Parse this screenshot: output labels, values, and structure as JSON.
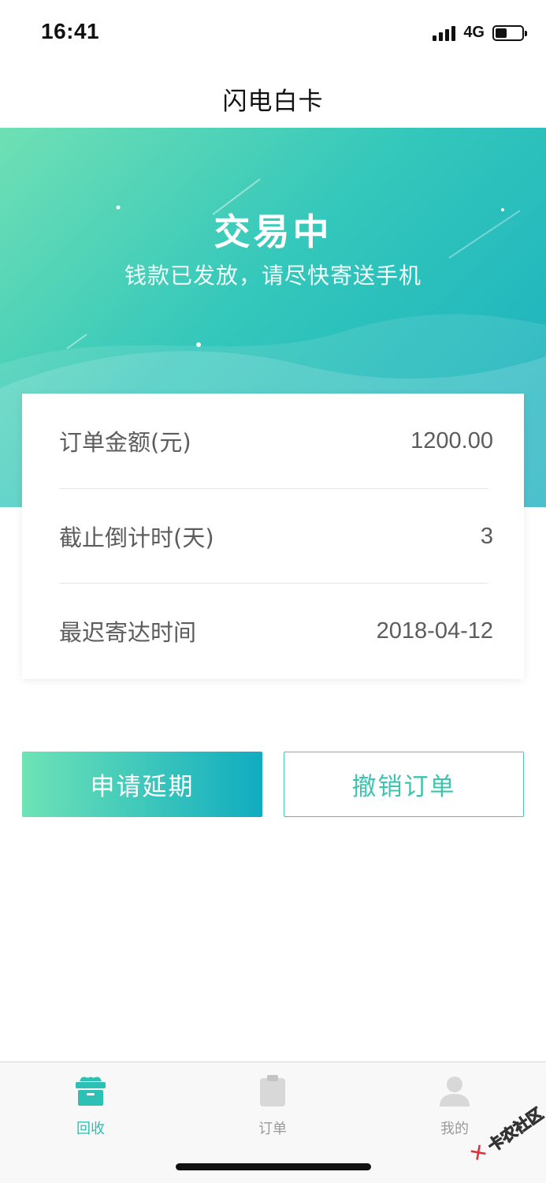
{
  "status_bar": {
    "time": "16:41",
    "network": "4G",
    "signal_bars": 4,
    "battery_level": 0.45
  },
  "nav": {
    "title": "闪电白卡"
  },
  "hero": {
    "title": "交易中",
    "subtitle": "钱款已发放，请尽快寄送手机",
    "gradient_colors": [
      "#6fe0b4",
      "#17aebf"
    ]
  },
  "order_info": {
    "rows": [
      {
        "label": "订单金额(元)",
        "value": "1200.00"
      },
      {
        "label": "截止倒计时(天)",
        "value": "3"
      },
      {
        "label": "最迟寄达时间",
        "value": "2018-04-12"
      }
    ]
  },
  "actions": {
    "extend_label": "申请延期",
    "cancel_label": "撤销订单"
  },
  "tab_bar": {
    "items": [
      {
        "label": "回收",
        "icon": "box-icon",
        "active": true
      },
      {
        "label": "订单",
        "icon": "clipboard-icon",
        "active": false
      },
      {
        "label": "我的",
        "icon": "person-icon",
        "active": false
      }
    ],
    "active_color": "#2ec0b4",
    "inactive_color": "#9a9a9a"
  },
  "watermark": {
    "text": "卡农社区"
  }
}
